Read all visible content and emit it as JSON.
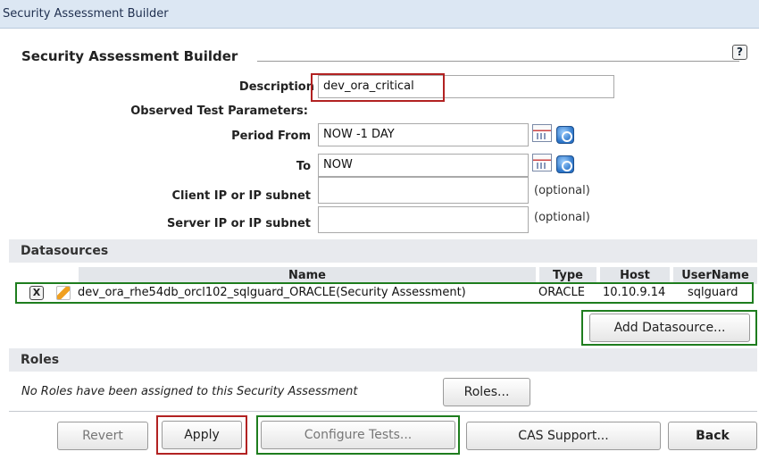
{
  "window": {
    "title": "Security Assessment Builder"
  },
  "header": {
    "title": "Security Assessment Builder",
    "help_label": "?"
  },
  "form": {
    "description_label": "Description",
    "description_value": "dev_ora_critical",
    "observed_label": "Observed Test Parameters:",
    "period_from_label": "Period From",
    "period_from_value": "NOW -1 DAY",
    "to_label": "To",
    "to_value": "NOW",
    "client_ip_label": "Client IP or IP subnet",
    "client_ip_value": "",
    "server_ip_label": "Server IP or IP subnet",
    "server_ip_value": "",
    "optional_label": "(optional)"
  },
  "datasources": {
    "title": "Datasources",
    "columns": {
      "name": "Name",
      "type": "Type",
      "host": "Host",
      "user": "UserName"
    },
    "rows": [
      {
        "remove_label": "X",
        "name": "dev_ora_rhe54db_orcl102_sqlguard_ORACLE(Security Assessment)",
        "type": "ORACLE",
        "host": "10.10.9.14",
        "user": "sqlguard"
      }
    ],
    "add_button": "Add Datasource..."
  },
  "roles": {
    "title": "Roles",
    "message": "No Roles have been assigned to this Security Assessment",
    "button": "Roles..."
  },
  "footer": {
    "revert": "Revert",
    "apply": "Apply",
    "configure": "Configure Tests...",
    "cas": "CAS Support...",
    "back": "Back"
  },
  "colors": {
    "highlight_red": "#b22222",
    "highlight_green": "#1e7d1e",
    "titlebar": "#dce7f3"
  }
}
